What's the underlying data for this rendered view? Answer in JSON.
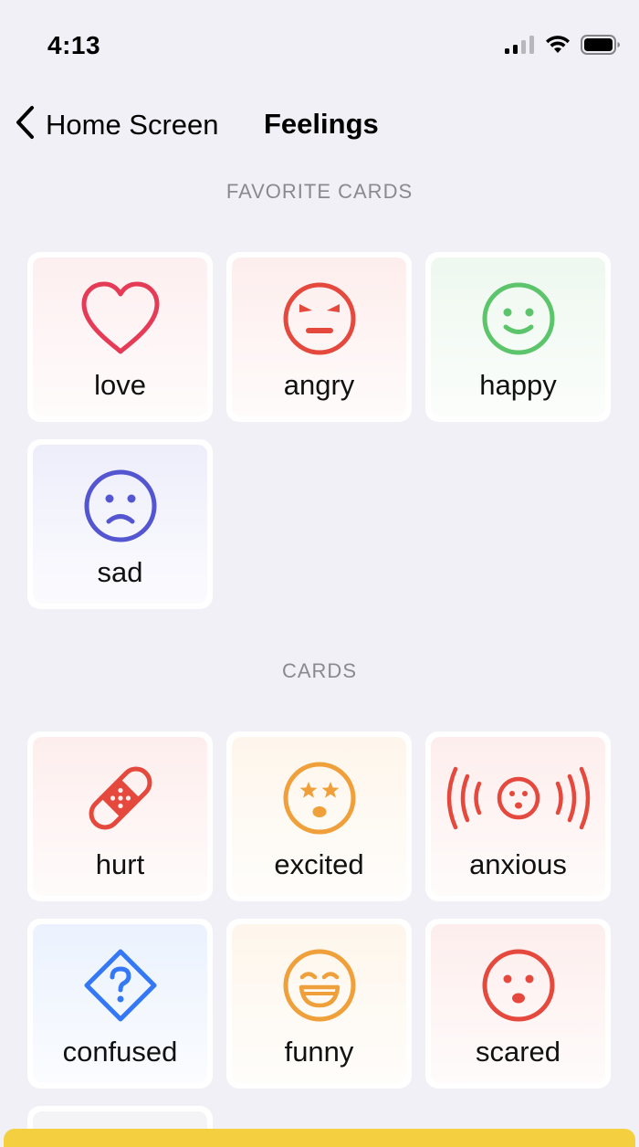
{
  "status_bar": {
    "time": "4:13",
    "icons": [
      "cellular-signal-icon",
      "wifi-icon",
      "battery-icon"
    ]
  },
  "nav": {
    "back_label": "Home Screen",
    "title": "Feelings"
  },
  "sections": {
    "favorites_header": "FAVORITE CARDS",
    "cards_header": "CARDS"
  },
  "favorite_cards": [
    {
      "label": "love",
      "icon": "heart-icon",
      "color": "#e63b57",
      "tint": "#fdeff0"
    },
    {
      "label": "angry",
      "icon": "angry-face-icon",
      "color": "#e5483c",
      "tint": "#fdeeed"
    },
    {
      "label": "happy",
      "icon": "smiling-face-icon",
      "color": "#5cc46a",
      "tint": "#eef8ef"
    },
    {
      "label": "sad",
      "icon": "sad-face-icon",
      "color": "#5456d1",
      "tint": "#eeeefb"
    }
  ],
  "cards": [
    {
      "label": "hurt",
      "icon": "bandage-icon",
      "color": "#e5483c",
      "tint": "#fdeeed"
    },
    {
      "label": "excited",
      "icon": "star-struck-face-icon",
      "color": "#f0a03a",
      "tint": "#fef6ec"
    },
    {
      "label": "anxious",
      "icon": "vibrating-face-icon",
      "color": "#e5483c",
      "tint": "#fdeeed"
    },
    {
      "label": "confused",
      "icon": "question-diamond-icon",
      "color": "#3478f6",
      "tint": "#ebf2fe"
    },
    {
      "label": "funny",
      "icon": "grinning-face-icon",
      "color": "#f0a03a",
      "tint": "#fef6ec"
    },
    {
      "label": "scared",
      "icon": "scared-face-icon",
      "color": "#e5483c",
      "tint": "#fdeeed"
    }
  ],
  "accent": {
    "bottom_bar": "#f4cf3f",
    "background": "#f1f0f6"
  }
}
